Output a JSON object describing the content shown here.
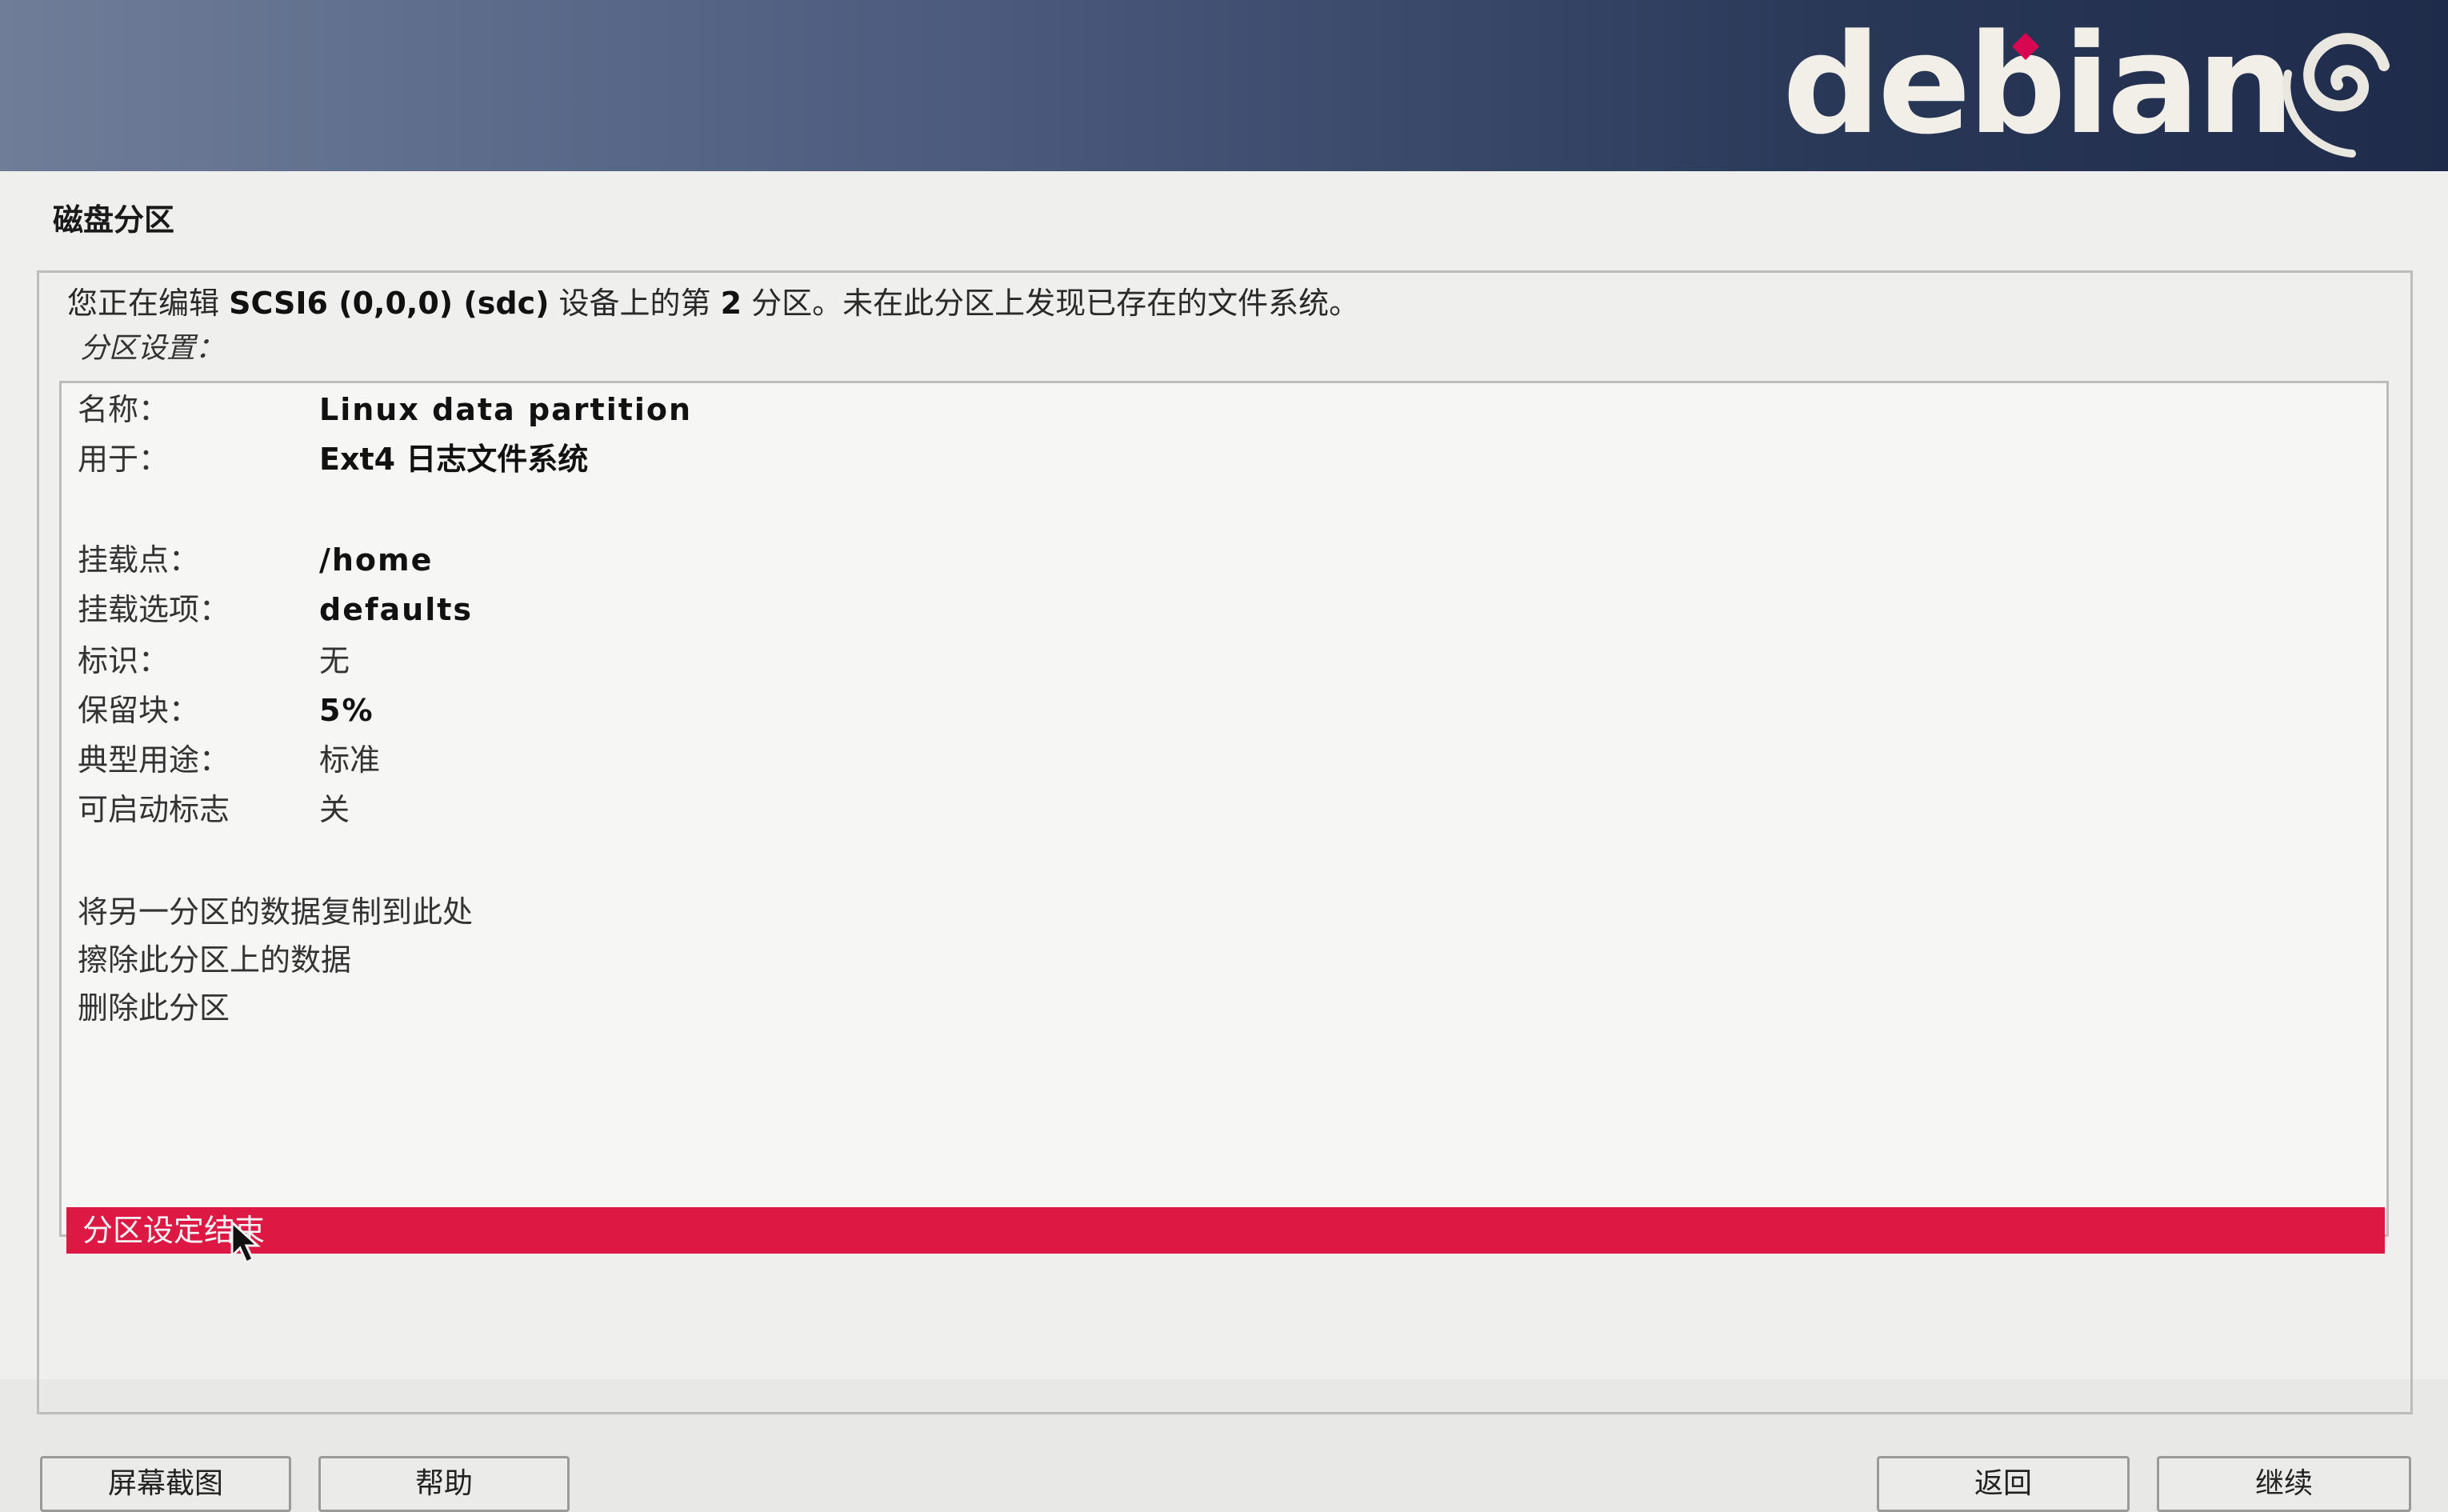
{
  "header": {
    "logo_text": "debian",
    "logo_icon": "debian-swirl-icon"
  },
  "section_title": "磁盘分区",
  "description": {
    "prefix": "您正在编辑 ",
    "device": "SCSI6 (0,0,0) (sdc)",
    "middle": " 设备上的第 ",
    "number": "2",
    "suffix": " 分区。未在此分区上发现已存在的文件系统。"
  },
  "subtitle": "分区设置：",
  "settings": [
    {
      "key": "名称：",
      "value": "Linux data partition",
      "bold": true
    },
    {
      "key": "用于：",
      "value": "Ext4 日志文件系统",
      "bold": false
    },
    {
      "key": "挂载点：",
      "value": "/home",
      "bold": true
    },
    {
      "key": "挂载选项：",
      "value": "defaults",
      "bold": true
    },
    {
      "key": "标识：",
      "value": "无",
      "bold": false
    },
    {
      "key": "保留块：",
      "value": "5%",
      "bold": true
    },
    {
      "key": "典型用途：",
      "value": "标准",
      "bold": false
    },
    {
      "key": "可启动标志",
      "value": "关",
      "bold": false
    }
  ],
  "actions": [
    "将另一分区的数据复制到此处",
    "擦除此分区上的数据",
    "删除此分区"
  ],
  "selected_action": "分区设定结束",
  "colors": {
    "selection": "#dc1843",
    "logo_accent": "#d70751"
  },
  "buttons": {
    "screenshot": "屏幕截图",
    "help": "帮助",
    "back": "返回",
    "continue": "继续"
  }
}
